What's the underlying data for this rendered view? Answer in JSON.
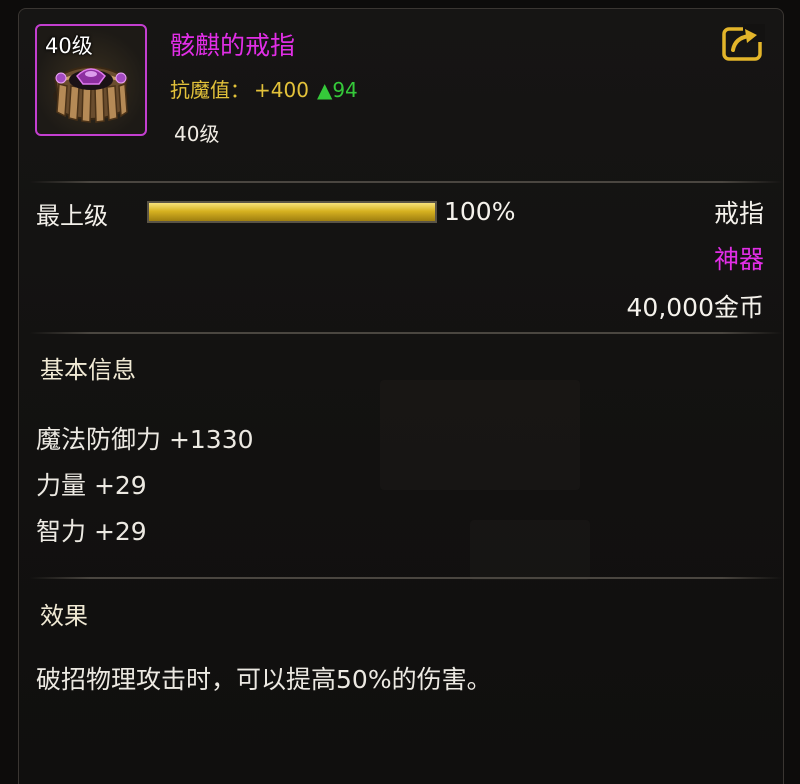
{
  "item": {
    "icon_level": "40级",
    "name": "骸麒的戒指",
    "resist_label": "抗魔值：",
    "resist_value": "+400",
    "resist_up": "▲94",
    "level": "40级"
  },
  "grade": {
    "label": "最上级",
    "percent": 100,
    "percent_text": "100%"
  },
  "meta": {
    "type": "戒指",
    "rarity": "神器",
    "price": "40,000金币"
  },
  "basic_info": {
    "title": "基本信息",
    "stats": [
      "魔法防御力 +1330",
      "力量 +29",
      "智力 +29"
    ]
  },
  "effect": {
    "title": "效果",
    "text": "破招物理攻击时，可以提高50%的伤害。"
  },
  "icons": {
    "item_icon": "ring-icon",
    "share": "share-icon"
  },
  "colors": {
    "name": "#e12ee6",
    "resist": "#e3c23a",
    "increase": "#35c93a",
    "bar_fill": "#d7b221",
    "frame": "#c33fd0"
  }
}
